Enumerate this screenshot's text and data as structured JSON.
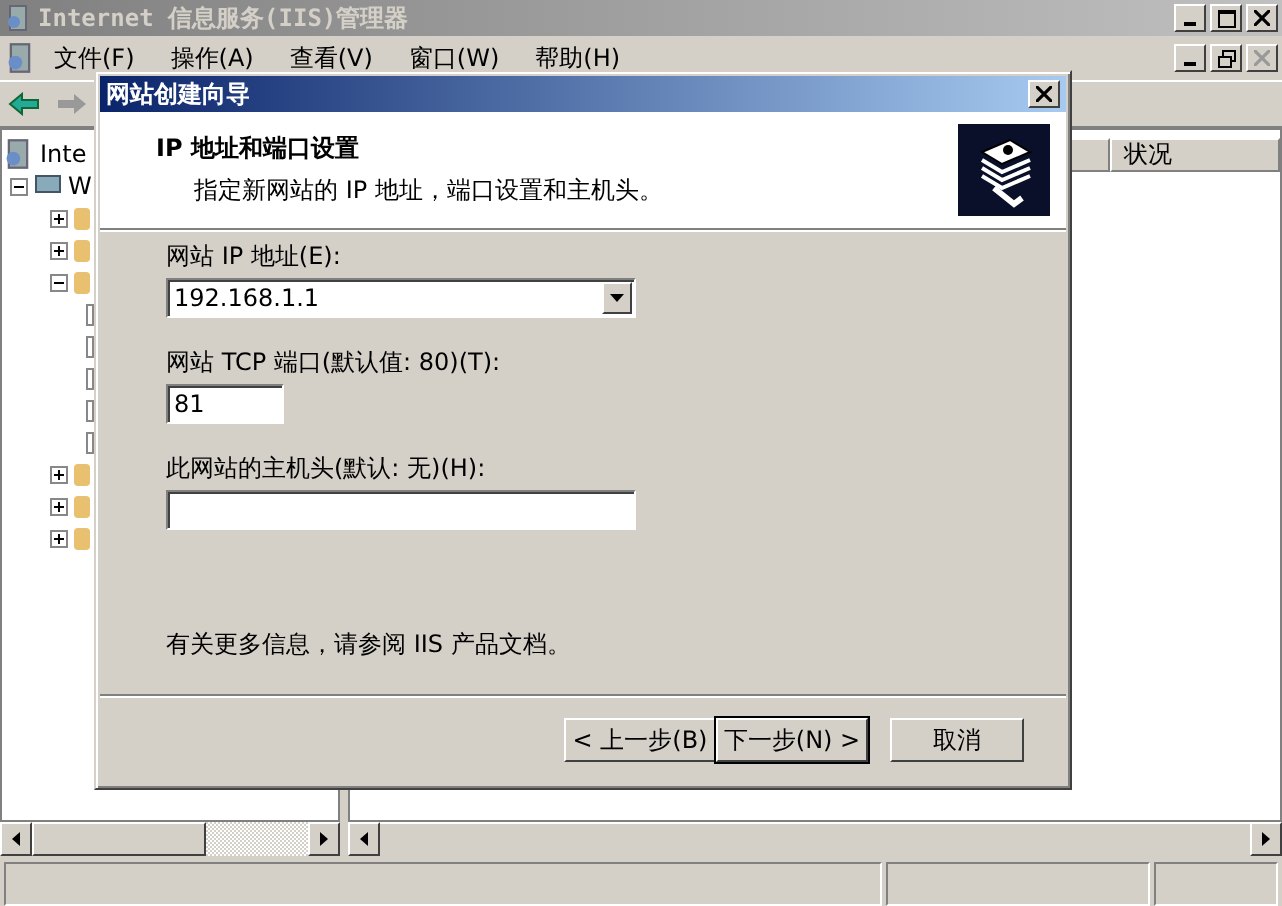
{
  "app_window": {
    "title": "Internet 信息服务(IIS)管理器",
    "menu": [
      "文件(F)",
      "操作(A)",
      "查看(V)",
      "窗口(W)",
      "帮助(H)"
    ]
  },
  "tree": {
    "items": [
      {
        "label": "Inte",
        "children": [
          {
            "label": "W",
            "expanded": true,
            "children": [
              {
                "kind": "node",
                "expanded": false
              },
              {
                "kind": "node",
                "expanded": false
              },
              {
                "kind": "node",
                "expanded": true
              },
              {
                "kind": "leaf"
              },
              {
                "kind": "leaf"
              },
              {
                "kind": "leaf"
              },
              {
                "kind": "leaf"
              },
              {
                "kind": "leaf"
              },
              {
                "kind": "node",
                "expanded": false
              },
              {
                "kind": "node",
                "expanded": false
              },
              {
                "kind": "node",
                "expanded": false
              }
            ]
          }
        ]
      }
    ]
  },
  "list": {
    "columns": [
      "状况"
    ]
  },
  "dialog": {
    "title": "网站创建向导",
    "heading": "IP 地址和端口设置",
    "subheading": "指定新网站的 IP 地址，端口设置和主机头。",
    "fields": [
      {
        "kind": "dropdown",
        "label": "网站 IP 地址(E):",
        "value": "192.168.1.1"
      },
      {
        "kind": "short-text",
        "label": "网站 TCP 端口(默认值: 80)(T):",
        "value": "81"
      },
      {
        "kind": "text",
        "label": "此网站的主机头(默认: 无)(H):"
      }
    ],
    "note": "有关更多信息，请参阅 IIS 产品文档。",
    "buttons": [
      {
        "label": "< 上一步(B)",
        "default": false
      },
      {
        "label": "下一步(N) >",
        "default": true
      },
      {
        "label": "取消",
        "default": false
      }
    ]
  }
}
